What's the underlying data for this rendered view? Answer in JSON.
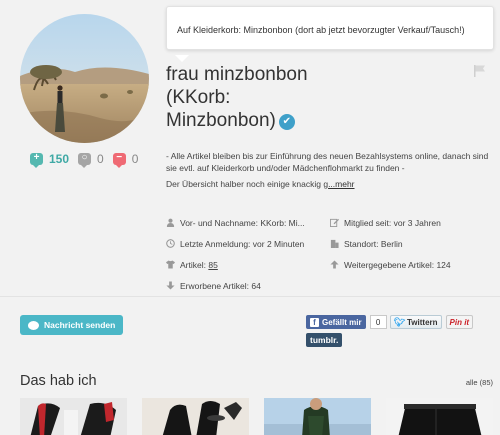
{
  "tooltip": {
    "text": "Auf Kleiderkorb: Minzbonbon (dort ab jetzt bevorzugter Verkauf/Tausch!)"
  },
  "profile": {
    "name": "frau minzbonbon (KKorb: Minzbonbon)",
    "verified_icon": "check-badge-icon",
    "stats": [
      {
        "icon": "plus-icon",
        "value": "150"
      },
      {
        "icon": "circle-icon",
        "value": "0"
      },
      {
        "icon": "minus-icon",
        "value": "0"
      }
    ]
  },
  "bio": {
    "paragraph1": "- Alle Artikel bleiben bis zur Einführung des neuen Bezahlsystems online, danach sind sie evtl. auf Kleiderkorb und/oder Mädchenflohmarkt zu finden -",
    "paragraph2": "Der Übersicht halber noch einige knackig g",
    "more": "...mehr"
  },
  "info": {
    "fullname": "Vor- und Nachname: KKorb: Mi...",
    "member_since": "Mitglied seit: vor 3 Jahren",
    "last_login": "Letzte Anmeldung: vor 2 Minuten",
    "location": "Standort: Berlin",
    "articles_label": "Artikel:",
    "articles_count": "85",
    "passed_on": "Weitergegebene Artikel: 124",
    "acquired": "Erworbene Artikel: 64"
  },
  "actions": {
    "send_message": "Nachricht senden"
  },
  "share": {
    "facebook_label": "Gefällt mir",
    "facebook_count": "0",
    "twitter_label": "Twittern",
    "pinterest_label": "Pin it",
    "tumblr_label": "tumblr."
  },
  "section": {
    "title": "Das hab ich",
    "all_link": "alle (85)"
  },
  "colors": {
    "accent": "#4bb7c7",
    "stat_green": "#55b8b0",
    "stat_red": "#ef6a74",
    "verified": "#3fa0c9"
  }
}
